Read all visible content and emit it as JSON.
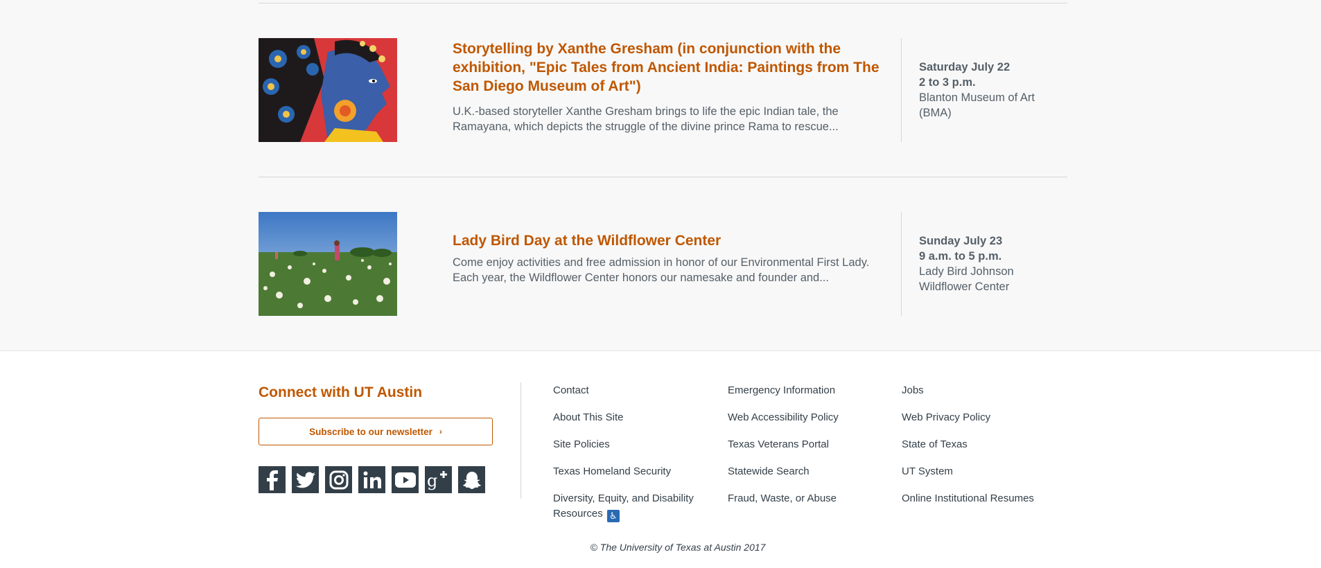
{
  "events": [
    {
      "title": "Storytelling by Xanthe Gresham (in conjunction with the exhibition, \"Epic Tales from Ancient India: Paintings from The San Diego Museum of Art\")",
      "description": "U.K.-based storyteller Xanthe Gresham brings to life the epic Indian tale, the Ramayana, which depicts the struggle of the divine prince Rama to rescue...",
      "day": "Saturday July 22",
      "time": "2 to 3 p.m.",
      "location": "Blanton Museum of Art (BMA)",
      "image_icon": "indian-painting-image"
    },
    {
      "title": "Lady Bird Day at the Wildflower Center",
      "description": "Come enjoy activities and free admission in honor of our Environmental First Lady. Each year, the Wildflower Center honors our namesake and founder and...",
      "day": "Sunday July 23",
      "time": "9 a.m. to 5 p.m.",
      "location": "Lady Bird Johnson Wildflower Center",
      "image_icon": "wildflower-field-image"
    }
  ],
  "footer": {
    "connect_heading": "Connect with UT Austin",
    "subscribe_label": "Subscribe to our newsletter",
    "social_icons": [
      "facebook-icon",
      "twitter-icon",
      "instagram-icon",
      "linkedin-icon",
      "youtube-icon",
      "google-plus-icon",
      "snapchat-icon"
    ],
    "links_col1": [
      "Contact",
      "About This Site",
      "Site Policies",
      "Texas Homeland Security",
      "Diversity, Equity, and Disability Resources"
    ],
    "links_col2": [
      "Emergency Information",
      "Web Accessibility Policy",
      "Texas Veterans Portal",
      "Statewide Search",
      "Fraud, Waste, or Abuse"
    ],
    "links_col3": [
      "Jobs",
      "Web Privacy Policy",
      "State of Texas",
      "UT System",
      "Online Institutional Resumes"
    ],
    "copyright_prefix": "©",
    "copyright_text": "The University of Texas at Austin 2017"
  },
  "colors": {
    "accent": "#bf5700",
    "text": "#333f48",
    "background_events": "#f8f8f8"
  }
}
